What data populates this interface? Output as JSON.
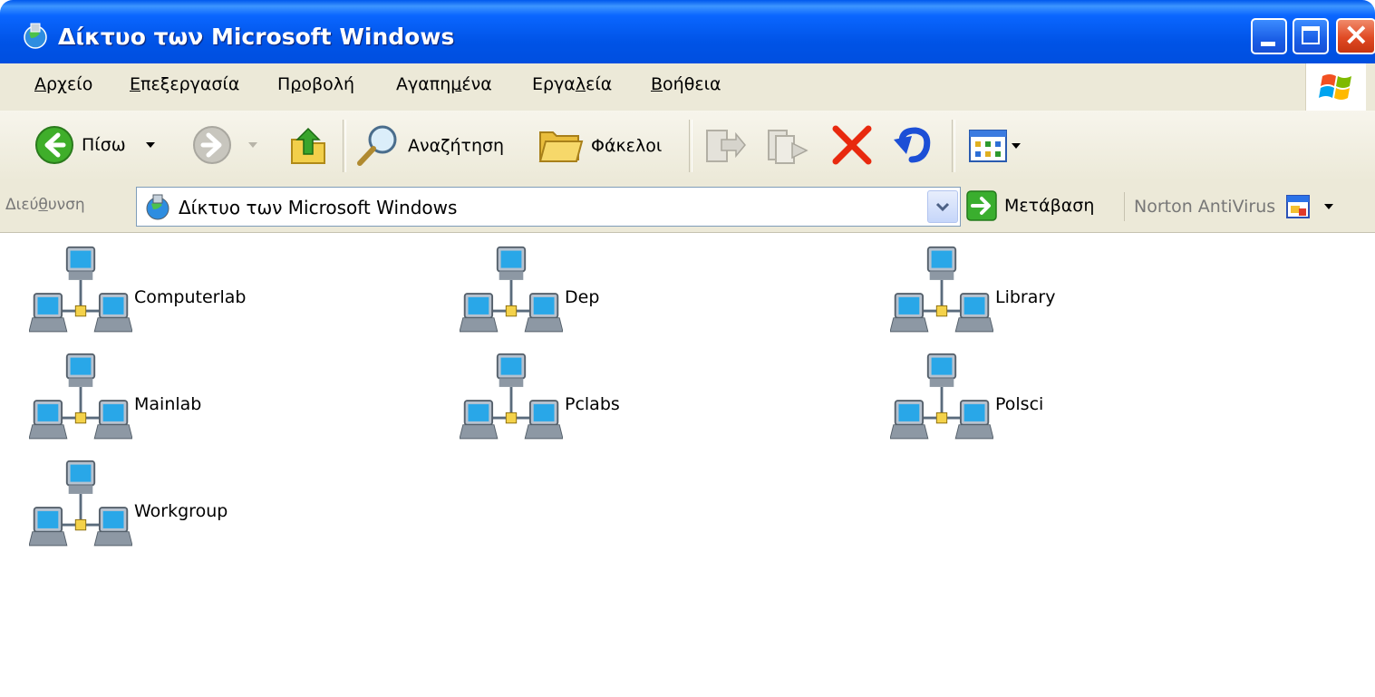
{
  "window": {
    "title": "Δίκτυο των Microsoft Windows"
  },
  "menu": [
    {
      "pre": "",
      "ul": "Α",
      "post": "ρχείο"
    },
    {
      "pre": "",
      "ul": "Ε",
      "post": "πεξεργασία"
    },
    {
      "pre": "Π",
      "ul": "ρ",
      "post": "οβολή"
    },
    {
      "pre": "Αγαπη",
      "ul": "μ",
      "post": "ένα"
    },
    {
      "pre": "Εργα",
      "ul": "λ",
      "post": "εία"
    },
    {
      "pre": "",
      "ul": "Β",
      "post": "οήθεια"
    }
  ],
  "toolbar": {
    "back_label": "Πίσω",
    "search_label": "Αναζήτηση",
    "folders_label": "Φάκελοι"
  },
  "address": {
    "label_pre": "Διεύ",
    "label_ul": "θ",
    "label_post": "υνση",
    "value": "Δίκτυο των Microsoft Windows",
    "go_label": "Μετάβαση",
    "norton_label": "Norton AntiVirus"
  },
  "items": [
    {
      "label": "Computerlab"
    },
    {
      "label": "Dep"
    },
    {
      "label": "Library"
    },
    {
      "label": "Mainlab"
    },
    {
      "label": "Pclabs"
    },
    {
      "label": "Polsci"
    },
    {
      "label": "Workgroup"
    }
  ],
  "colors": {
    "titlebar": "#0053e6",
    "chrome": "#ece9d8",
    "close_button": "#e04a24"
  }
}
